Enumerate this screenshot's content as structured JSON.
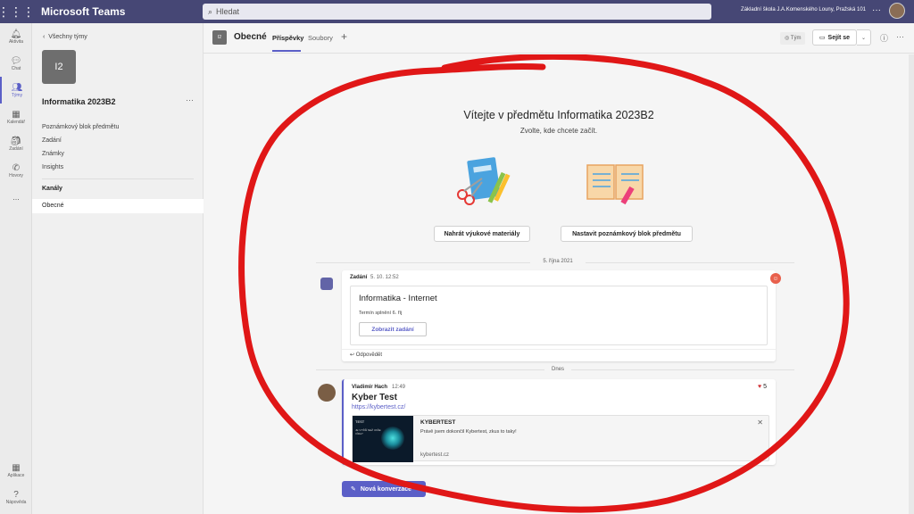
{
  "app": {
    "name": "Microsoft Teams",
    "search_placeholder": "Hledat",
    "school": "Základní škola J.A.Komenského Louny, Pražská 101"
  },
  "rail": [
    {
      "label": "Aktivita",
      "icon": "bell-icon"
    },
    {
      "label": "Chat",
      "icon": "chat-icon"
    },
    {
      "label": "Týmy",
      "icon": "teams-icon"
    },
    {
      "label": "Kalendář",
      "icon": "calendar-icon"
    },
    {
      "label": "Zadání",
      "icon": "assignments-icon"
    },
    {
      "label": "Hovory",
      "icon": "phone-icon"
    },
    {
      "label": "...",
      "icon": "more-icon"
    }
  ],
  "rail_bottom": [
    {
      "label": "Aplikace",
      "icon": "apps-icon"
    },
    {
      "label": "Nápověda",
      "icon": "help-icon"
    }
  ],
  "team": {
    "back": "Všechny týmy",
    "initials": "I2",
    "name": "Informatika 2023B2",
    "more": "···",
    "links": [
      "Poznámkový blok předmětu",
      "Zadání",
      "Známky",
      "Insights"
    ],
    "channels_label": "Kanály",
    "channel": "Obecné"
  },
  "header": {
    "initials": "I2",
    "title": "Obecné",
    "tabs": [
      "Příspěvky",
      "Soubory"
    ],
    "add": "+",
    "team_pill": "Tým",
    "meet": "Sejít se",
    "meet_drop": "⌄",
    "info": "ⓘ",
    "more": "···"
  },
  "welcome": {
    "title": "Vítejte v předmětu Informatika 2023B2",
    "subtitle": "Zvolte, kde chcete začít.",
    "btn1": "Nahrát výukové materiály",
    "btn2": "Nastavit poznámkový blok předmětu"
  },
  "feed": {
    "date1": "5. října 2021",
    "post1": {
      "author": "Zadání",
      "time": "5. 10. 12:52",
      "card_title": "Informatika - Internet",
      "due": "Termín splnění 6. říj",
      "button": "Zobrazit zadání",
      "reply": "Odpovědět"
    },
    "date2": "Dnes",
    "post2": {
      "author": "Vladimír Hach",
      "time": "12:49",
      "title": "Kyber Test",
      "link": "https://kybertest.cz/",
      "likes": "5",
      "preview_title": "KYBERTEST",
      "preview_text": "Právě jsem dokončil Kybertest, zkus to taky!",
      "preview_domain": "kybertest.cz",
      "thumb_title": "TEST",
      "thumb_text": "JE VYŠŠÍ NEŽ VAŠE VÍRA?",
      "close": "✕"
    }
  },
  "new_conversation": "Nová konverzace"
}
